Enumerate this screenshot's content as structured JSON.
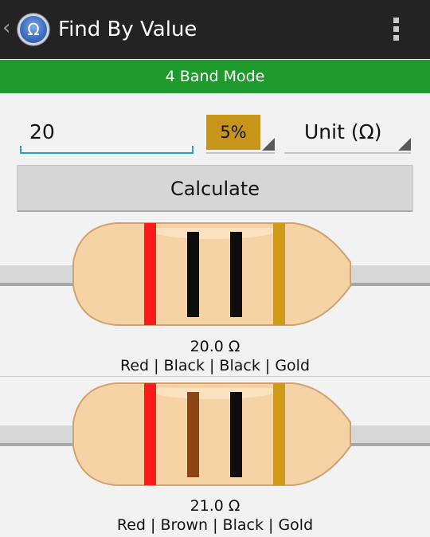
{
  "app": {
    "title": "Find By Value",
    "icon_symbol": "Ω",
    "mode": "4 Band Mode"
  },
  "form": {
    "value": "20",
    "tolerance": "5%",
    "unit": "Unit (Ω)",
    "calculate_label": "Calculate"
  },
  "results": [
    {
      "value": "20.0 Ω",
      "colors_text": "Red | Black | Black | Gold",
      "bands": [
        "#ff1a1a",
        "#0d0d0d",
        "#0d0d0d",
        "#cf9a16"
      ]
    },
    {
      "value": "21.0 Ω",
      "colors_text": "Red | Brown | Black | Gold",
      "bands": [
        "#ff1a1a",
        "#8b4513",
        "#0d0d0d",
        "#cf9a16"
      ]
    }
  ],
  "colors": {
    "action_bar": "#232323",
    "mode_bar": "#1f9a2c",
    "input_underline": "#2ba1c7",
    "tolerance_chip": "#c7951a",
    "resistor_body": "#f5d3a4"
  }
}
